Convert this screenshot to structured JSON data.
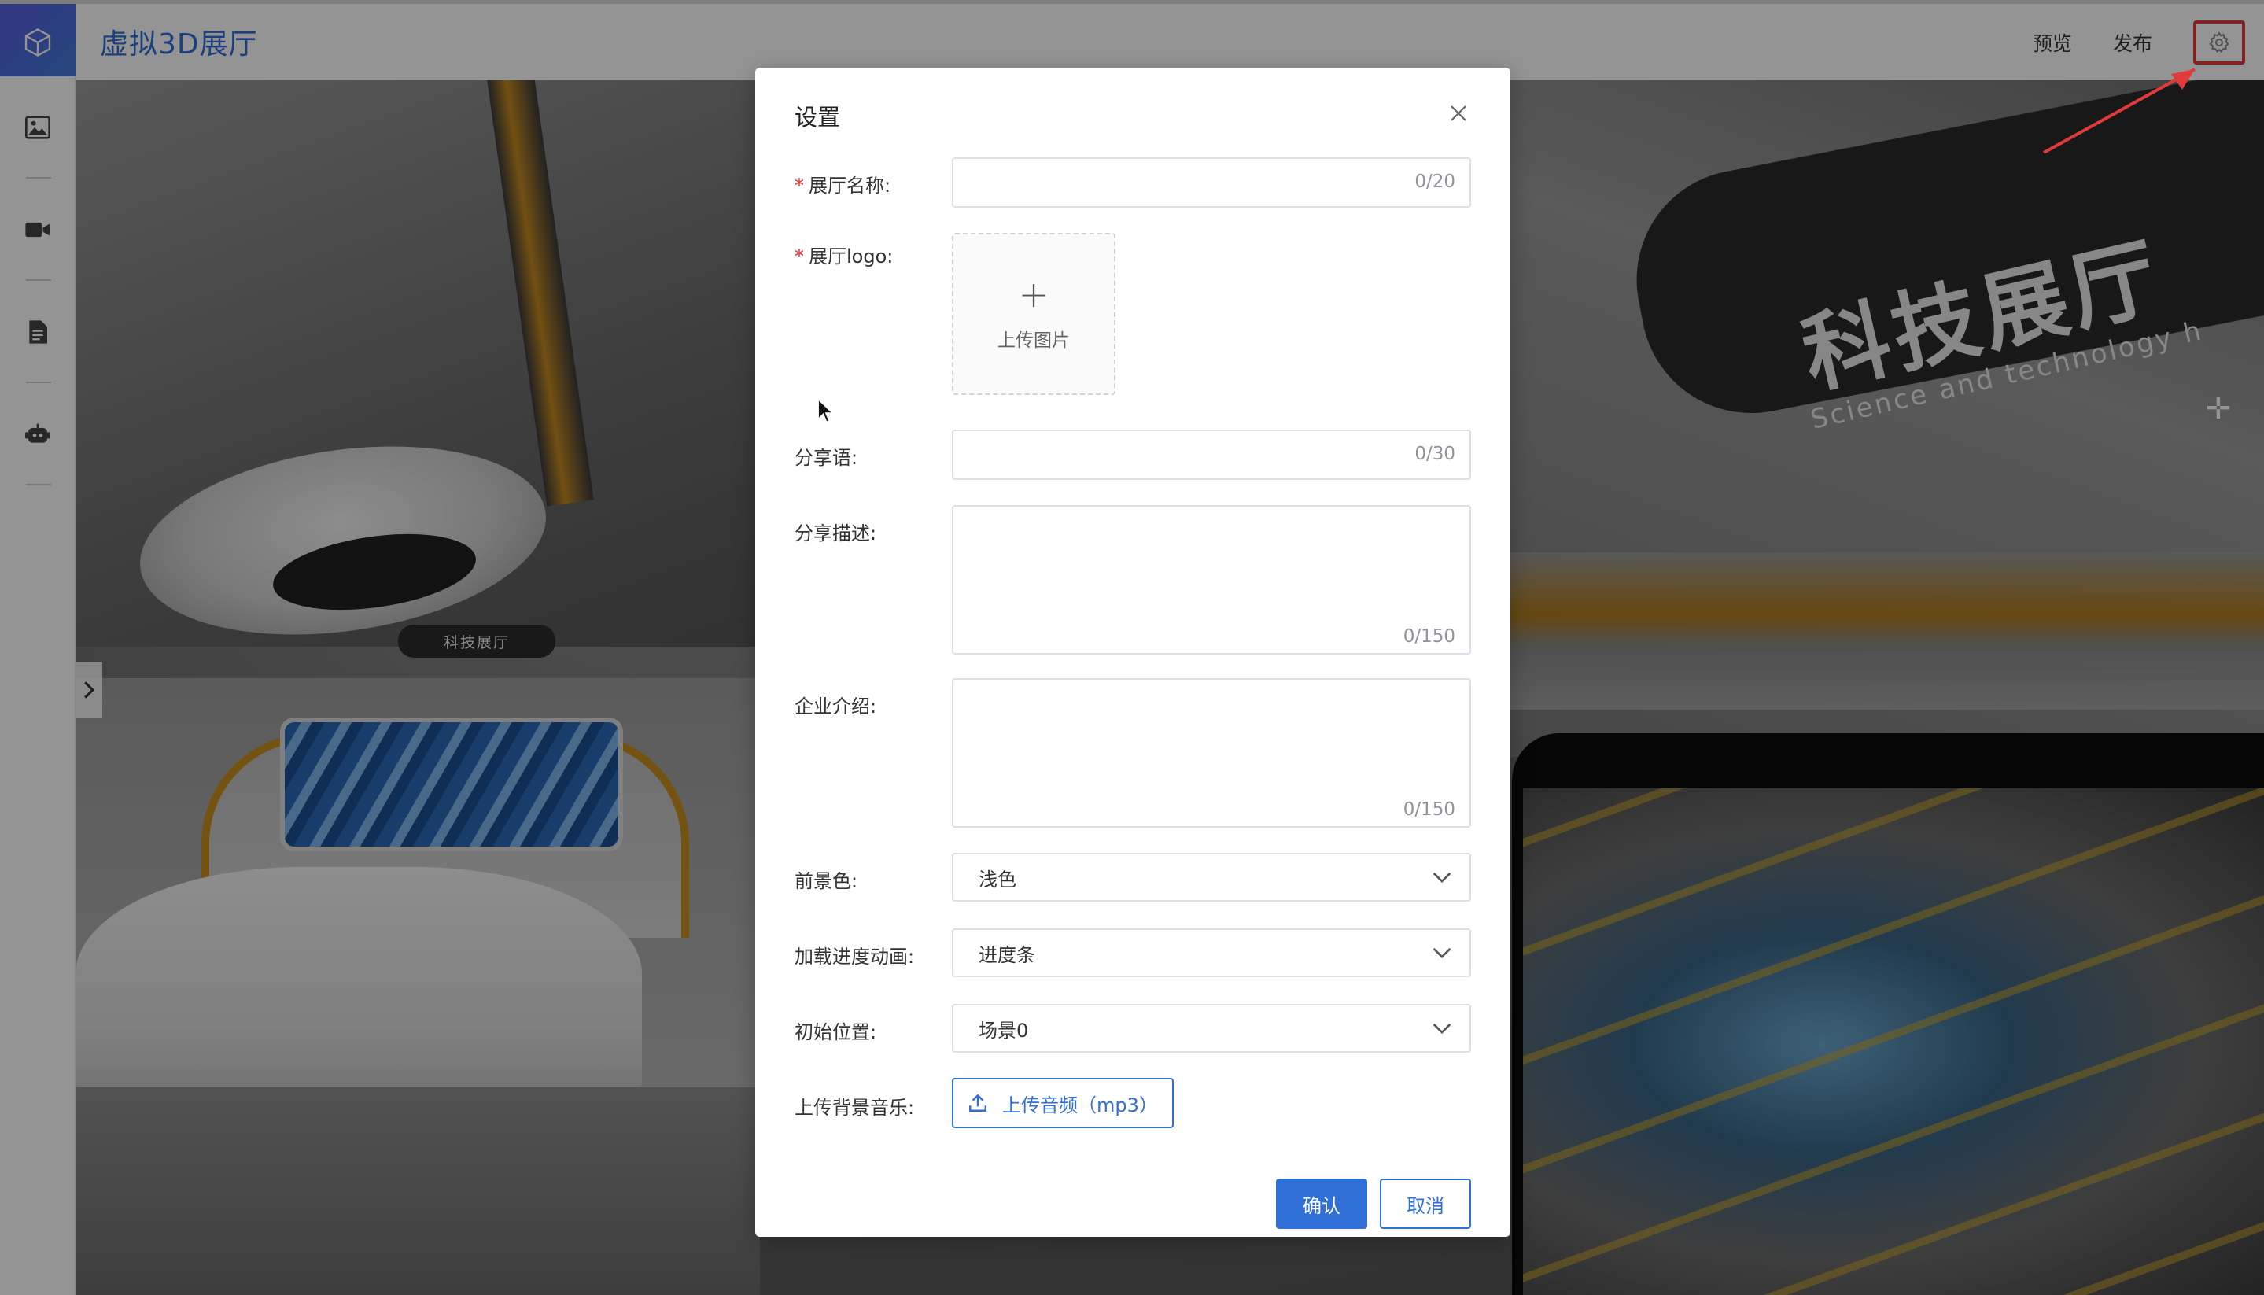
{
  "header": {
    "title": "虚拟3D展厅",
    "actions": {
      "preview": "预览",
      "publish": "发布"
    },
    "icons": {
      "logo": "cube-icon",
      "settings": "gear-icon"
    },
    "colors": {
      "brand": "#2f6fd6",
      "logo_bg": "#5b5fe0",
      "annotation": "#e03a3a"
    }
  },
  "toolbar": {
    "items": [
      {
        "icon": "image-icon"
      },
      {
        "icon": "video-icon"
      },
      {
        "icon": "document-icon"
      },
      {
        "icon": "robot-icon"
      }
    ]
  },
  "scene": {
    "left_sign": "科技展厅",
    "banner_cn": "科技展厅",
    "banner_en": "Science and technology h"
  },
  "modal": {
    "title": "设置",
    "fields": {
      "hall_name": {
        "label": "展厅名称:",
        "required": true,
        "value": "",
        "counter": "0/20"
      },
      "hall_logo": {
        "label": "展厅logo:",
        "required": true,
        "upload_text": "上传图片"
      },
      "share_text": {
        "label": "分享语:",
        "value": "",
        "counter": "0/30"
      },
      "share_desc": {
        "label": "分享描述:",
        "value": "",
        "counter": "0/150"
      },
      "company_intro": {
        "label": "企业介绍:",
        "value": "",
        "counter": "0/150"
      },
      "foreground_color": {
        "label": "前景色:",
        "selected": "浅色"
      },
      "loading_animation": {
        "label": "加载进度动画:",
        "selected": "进度条"
      },
      "initial_position": {
        "label": "初始位置:",
        "selected": "场景0"
      },
      "bg_music": {
        "label": "上传背景音乐:",
        "button": "上传音频（mp3）"
      }
    },
    "buttons": {
      "confirm": "确认",
      "cancel": "取消"
    }
  }
}
